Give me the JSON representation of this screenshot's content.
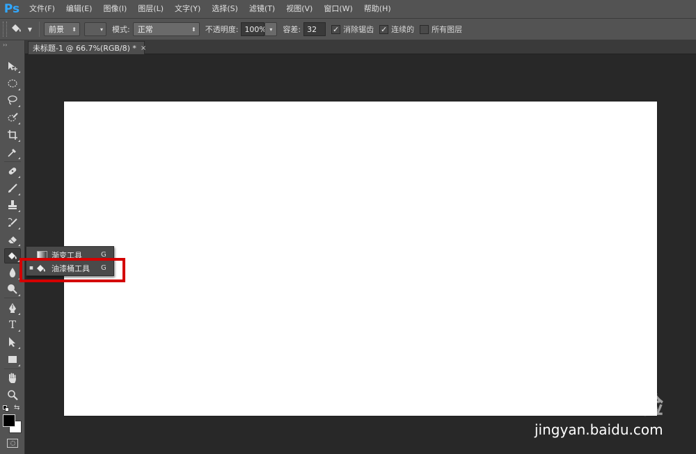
{
  "app": {
    "logo": "Ps"
  },
  "menu": [
    "文件(F)",
    "编辑(E)",
    "图像(I)",
    "图层(L)",
    "文字(Y)",
    "选择(S)",
    "滤镜(T)",
    "视图(V)",
    "窗口(W)",
    "帮助(H)"
  ],
  "options": {
    "tool_icon": "paint-bucket-icon",
    "fill_source": "前景",
    "pattern_label": "",
    "mode_label": "模式:",
    "mode_value": "正常",
    "opacity_label": "不透明度:",
    "opacity_value": "100%",
    "tolerance_label": "容差:",
    "tolerance_value": "32",
    "antialias_label": "消除锯齿",
    "antialias_checked": true,
    "contiguous_label": "连续的",
    "contiguous_checked": true,
    "all_layers_label": "所有图层",
    "all_layers_checked": false
  },
  "document": {
    "tab_title": "未标题-1 @ 66.7%(RGB/8) *",
    "close_glyph": "×",
    "canvas_color": "#ffffff"
  },
  "toolbar": {
    "grip": "››",
    "tools": [
      "move-tool-icon",
      "marquee-tool-icon",
      "lasso-tool-icon",
      "quick-select-tool-icon",
      "crop-tool-icon",
      "eyedropper-tool-icon",
      "healing-brush-tool-icon",
      "brush-tool-icon",
      "clone-stamp-tool-icon",
      "history-brush-tool-icon",
      "eraser-tool-icon",
      "paint-bucket-tool-icon",
      "blur-tool-icon",
      "dodge-tool-icon",
      "pen-tool-icon",
      "type-tool-icon",
      "path-select-tool-icon",
      "rectangle-tool-icon",
      "hand-tool-icon",
      "zoom-tool-icon"
    ],
    "type_glyph": "T",
    "foreground_color": "#000000",
    "background_color": "#ffffff"
  },
  "flyout": {
    "items": [
      {
        "label": "渐变工具",
        "shortcut": "G",
        "icon": "gradient-tool-icon",
        "selected": false
      },
      {
        "label": "油漆桶工具",
        "shortcut": "G",
        "icon": "paint-bucket-tool-icon",
        "selected": true
      }
    ],
    "selected_marker": "■",
    "highlight_color": "#d40000"
  },
  "watermark": {
    "logo": "Baidu经验",
    "url": "jingyan.baidu.com"
  }
}
